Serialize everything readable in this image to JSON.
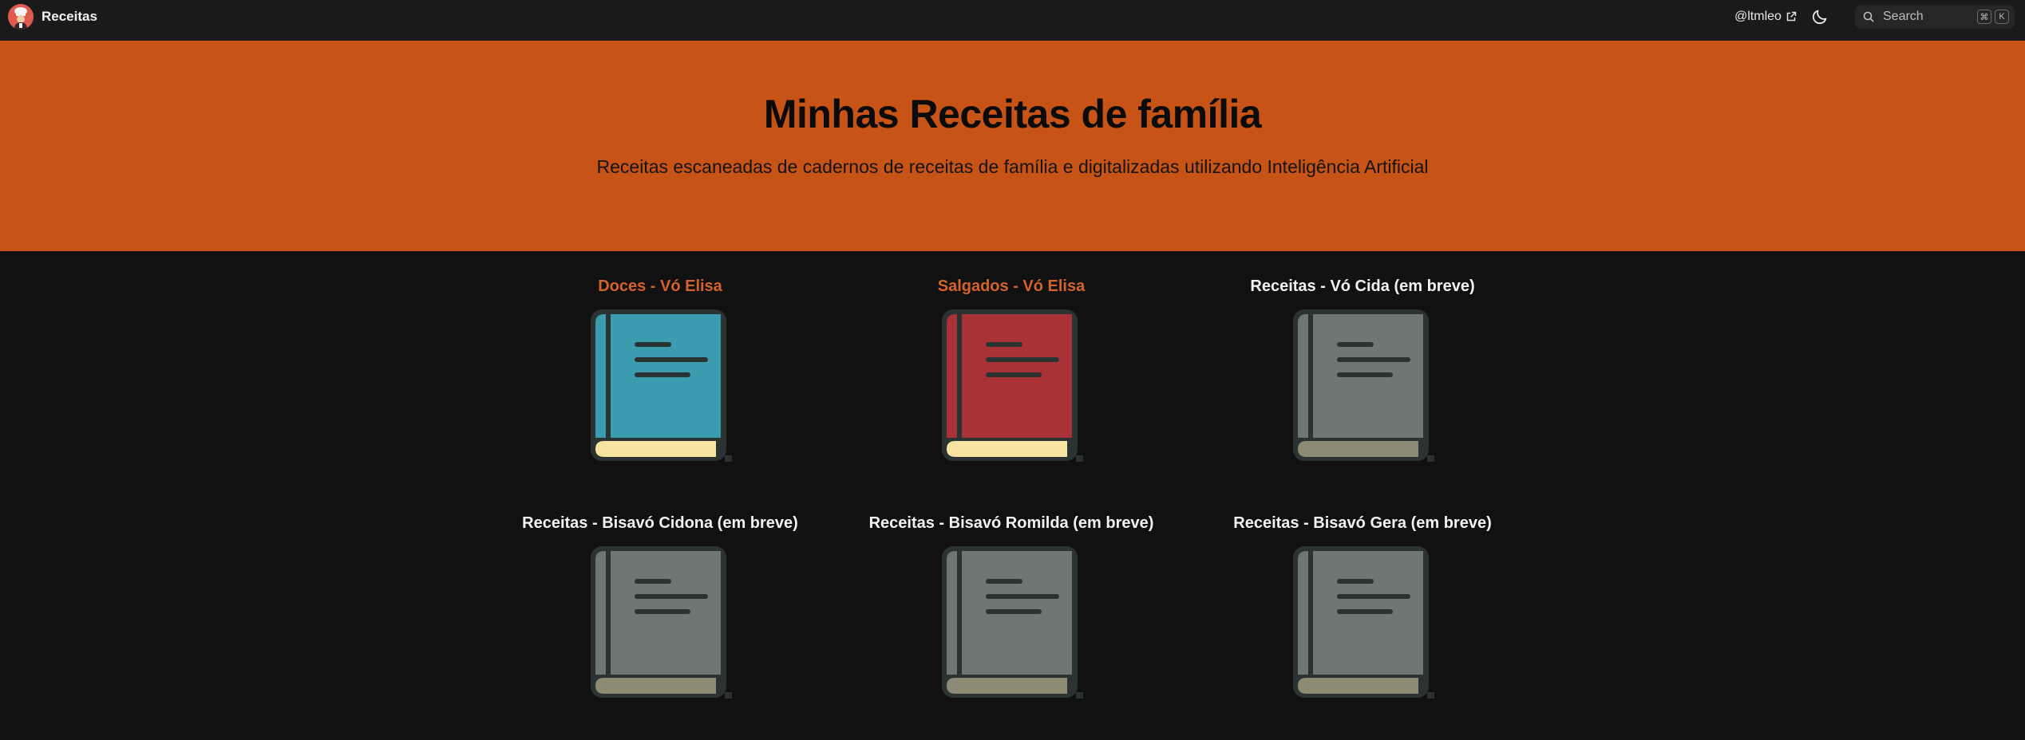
{
  "navbar": {
    "brand": "Receitas",
    "link_label": "@ltmleo",
    "search": {
      "placeholder": "Search",
      "shortcut_keys": [
        "⌘",
        "K"
      ]
    },
    "icons": {
      "external": "external-link-icon",
      "theme": "moon-icon",
      "search": "search-icon",
      "logo": "chef-avatar-icon"
    }
  },
  "hero": {
    "title": "Minhas Receitas de família",
    "subtitle": "Receitas escaneadas de cadernos de receitas de família e digitalizadas utilizando Inteligência Artificial"
  },
  "colors": {
    "hero_bg": "#c75316",
    "page_bg": "#111111",
    "navbar_bg": "#1a1a1a",
    "active_title": "#d4622a",
    "book_teal": "#3a9cae",
    "book_red": "#a93237",
    "book_gray": "#6e7676",
    "pages_yellow": "#f7e4a3",
    "pages_gray": "#8d8a76"
  },
  "books": [
    {
      "title": "Doces - Vó Elisa",
      "color": "teal",
      "available": true
    },
    {
      "title": "Salgados - Vó Elisa",
      "color": "red",
      "available": true
    },
    {
      "title": "Receitas - Vó Cida (em breve)",
      "color": "gray",
      "available": false
    },
    {
      "title": "Receitas - Bisavó Cidona (em breve)",
      "color": "gray",
      "available": false
    },
    {
      "title": "Receitas - Bisavó Romilda (em breve)",
      "color": "gray",
      "available": false
    },
    {
      "title": "Receitas - Bisavó Gera (em breve)",
      "color": "gray",
      "available": false
    }
  ]
}
